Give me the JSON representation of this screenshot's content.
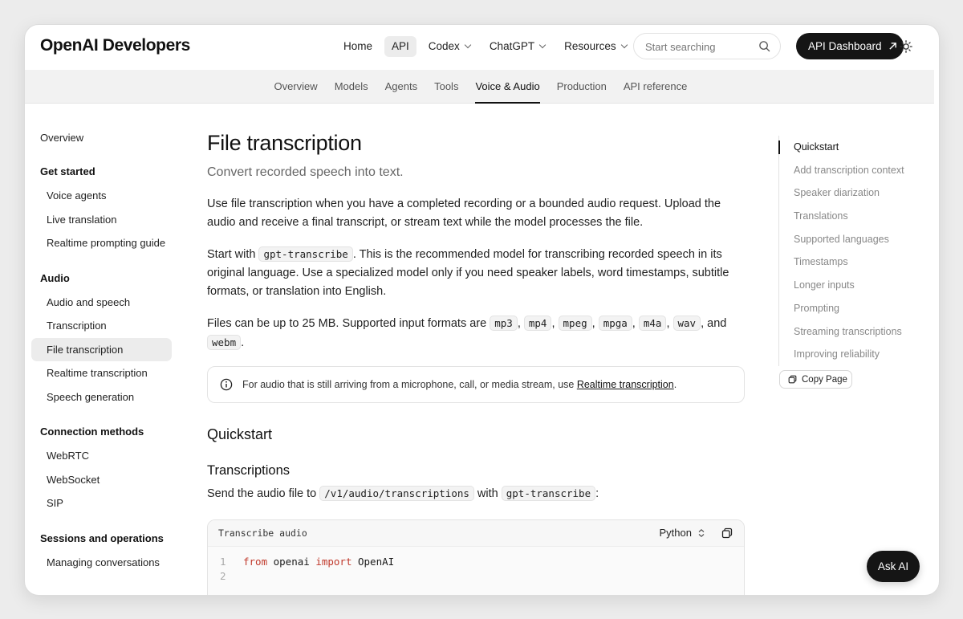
{
  "brand": {
    "logo": "OpenAI Developers"
  },
  "topnav": {
    "items": [
      "Home",
      "API",
      "Codex",
      "ChatGPT",
      "Resources"
    ],
    "search_placeholder": "Start searching",
    "dashboard_button": "API Dashboard"
  },
  "subnav": {
    "tabs": [
      "Overview",
      "Models",
      "Agents",
      "Tools",
      "Voice & Audio",
      "Production",
      "API reference"
    ]
  },
  "sidebar": {
    "overview": "Overview",
    "sections": [
      {
        "title": "Get started",
        "items": [
          "Voice agents",
          "Live translation",
          "Realtime prompting guide"
        ]
      },
      {
        "title": "Audio",
        "items": [
          "Audio and speech",
          "Transcription",
          "File transcription",
          "Realtime transcription",
          "Speech generation"
        ]
      },
      {
        "title": "Connection methods",
        "items": [
          "WebRTC",
          "WebSocket",
          "SIP"
        ]
      },
      {
        "title": "Sessions and operations",
        "items": [
          "Managing conversations"
        ]
      }
    ]
  },
  "main": {
    "title": "File transcription",
    "subtitle": "Convert recorded speech into text.",
    "p1": "Use file transcription when you have a completed recording or a bounded audio request. Upload the audio and receive a final transcript, or stream text while the model processes the file.",
    "p2_start": "Start with ",
    "p2_code": "gpt-transcribe",
    "p2_rest": ". This is the recommended model for transcribing recorded speech in its original language. Use a specialized model only if you need speaker labels, word timestamps, subtitle formats, or translation into English.",
    "p3_start": "Files can be up to 25 MB. Supported input formats are ",
    "formats": [
      "mp3",
      "mp4",
      "mpeg",
      "mpga",
      "m4a",
      "wav"
    ],
    "p3_and": ", and ",
    "format_last": "webm",
    "info_text": "For audio that is still arriving from a microphone, call, or media stream, use ",
    "info_link": "Realtime transcription",
    "h2": "Quickstart",
    "h3": "Transcriptions",
    "p4_start": "Send the audio file to ",
    "p4_code1": "/v1/audio/transcriptions",
    "p4_mid": " with ",
    "p4_code2": "gpt-transcribe",
    "p4_end": ":",
    "code": {
      "title": "Transcribe audio",
      "language": "Python",
      "lines": [
        {
          "n": "1",
          "kw1": "from",
          "mod": " openai ",
          "kw2": "import",
          "name": " OpenAI"
        },
        {
          "n": "2"
        }
      ]
    }
  },
  "toc": {
    "items": [
      "Quickstart",
      "Add transcription context",
      "Speaker diarization",
      "Translations",
      "Supported languages",
      "Timestamps",
      "Longer inputs",
      "Prompting",
      "Streaming transcriptions",
      "Improving reliability"
    ],
    "copy_page": "Copy Page"
  },
  "ask_ai": "Ask AI"
}
